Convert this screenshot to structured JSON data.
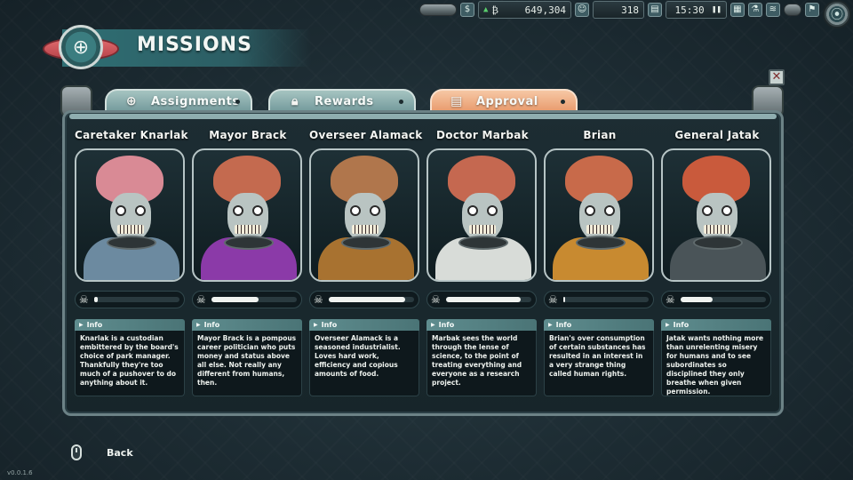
{
  "hud": {
    "money": "649,304",
    "money_icon": "dollar-icon",
    "money_trend": "up",
    "staff": "318",
    "time": "15:30",
    "pause_icon": "pause-icon"
  },
  "title": "MISSIONS",
  "tabs": [
    {
      "label": "Assignments",
      "icon": "target-icon",
      "active": false
    },
    {
      "label": "Rewards",
      "icon": "lock-icon",
      "active": false
    },
    {
      "label": "Approval",
      "icon": "clipboard-icon",
      "active": true
    }
  ],
  "info_label": "Info",
  "characters": [
    {
      "name": "Caretaker Knarlak",
      "approval": 0.04,
      "info": "Knarlak is a custodian embittered by the board's choice of park manager. Thankfully they're too much of a pushover to do anything about it.",
      "colors": {
        "brain": "#d98a95",
        "body": "#6c8aa0"
      }
    },
    {
      "name": "Mayor Brack",
      "approval": 0.55,
      "info": "Mayor Brack is a pompous career politician who puts money and status above all else. Not really any different from humans, then.",
      "colors": {
        "brain": "#c46a4f",
        "body": "#8b3aa8"
      }
    },
    {
      "name": "Overseer Alamack",
      "approval": 0.9,
      "info": "Overseer Alamack is a seasoned industrialist. Loves hard work, efficiency and copious amounts of food.",
      "colors": {
        "brain": "#b0764c",
        "body": "#a87230"
      }
    },
    {
      "name": "Doctor Marbak",
      "approval": 0.88,
      "info": "Marbak sees the world through the lense of science, to the point of treating everything and everyone as a research project.",
      "colors": {
        "brain": "#c56850",
        "body": "#d8dcd8"
      }
    },
    {
      "name": "Brian",
      "approval": 0.02,
      "info": "Brian's over consumption of certain substances has resulted in an interest in a very strange thing called human rights.",
      "colors": {
        "brain": "#c86a4a",
        "body": "#c88a30"
      }
    },
    {
      "name": "General Jatak",
      "approval": 0.38,
      "info": "Jatak wants nothing more than unrelenting misery for humans and to see subordinates so disciplined they only breathe when given permission.",
      "colors": {
        "brain": "#c95a3c",
        "body": "#4a5458"
      }
    }
  ],
  "back_label": "Back",
  "version": "v0.0.1.6"
}
